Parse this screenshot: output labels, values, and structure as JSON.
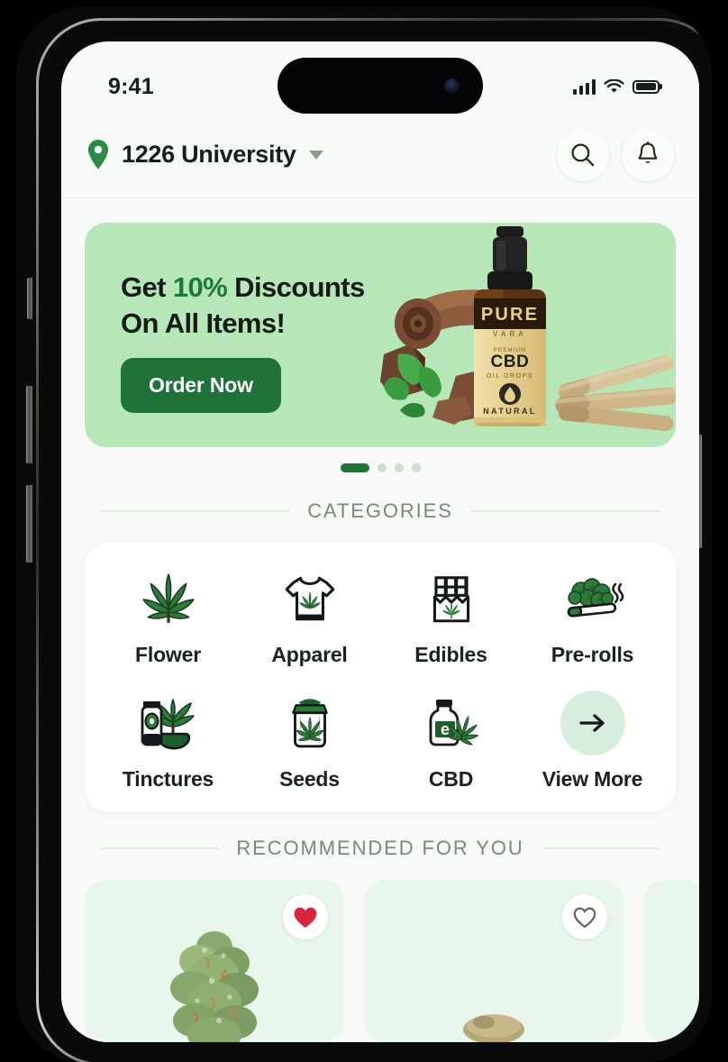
{
  "status_bar": {
    "time": "9:41",
    "signal_icon": "cellular-signal-icon",
    "wifi_icon": "wifi-icon",
    "battery_icon": "battery-full-icon"
  },
  "header": {
    "location_pin_icon": "location-pin-icon",
    "location": "1226 University",
    "caret_icon": "chevron-down-icon",
    "search_icon": "search-icon",
    "notification_icon": "bell-icon"
  },
  "promo": {
    "line1_prefix": "Get ",
    "line1_accent": "10%",
    "line1_suffix": " Discounts",
    "line2": "On All Items!",
    "cta_label": "Order Now",
    "product_name": "PURE",
    "product_sub": "CBD",
    "product_type": "OIL DROPS",
    "product_badge": "NATURAL",
    "banner_bg": "#b7e7b9",
    "accent_green": "#1c7a39",
    "cta_bg": "#1f7338"
  },
  "carousel": {
    "total": 4,
    "active_index": 0,
    "active_color": "#1f7338",
    "inactive_color": "#d3dbd4"
  },
  "sections": {
    "categories_title": "CATEGORIES",
    "recommended_title": "RECOMMENDED FOR YOU"
  },
  "categories": {
    "row1": [
      {
        "label": "Flower",
        "icon": "cannabis-leaf-icon"
      },
      {
        "label": "Apparel",
        "icon": "tshirt-icon"
      },
      {
        "label": "Edibles",
        "icon": "chocolate-bar-icon"
      },
      {
        "label": "Pre-rolls",
        "icon": "pre-roll-joint-icon"
      }
    ],
    "row2": [
      {
        "label": "Tinctures",
        "icon": "tincture-tube-icon"
      },
      {
        "label": "Seeds",
        "icon": "seed-bag-icon"
      },
      {
        "label": "CBD",
        "icon": "cbd-bottle-icon"
      },
      {
        "label": "View More",
        "icon": "arrow-right-icon"
      }
    ]
  },
  "recommended": {
    "cards": [
      {
        "favorited": true,
        "fav_icon": "heart-filled-icon",
        "art": "cannabis-bud-image"
      },
      {
        "favorited": false,
        "fav_icon": "heart-outline-icon",
        "art": "cannabis-product-image"
      }
    ],
    "fav_active_color": "#d9243c"
  }
}
